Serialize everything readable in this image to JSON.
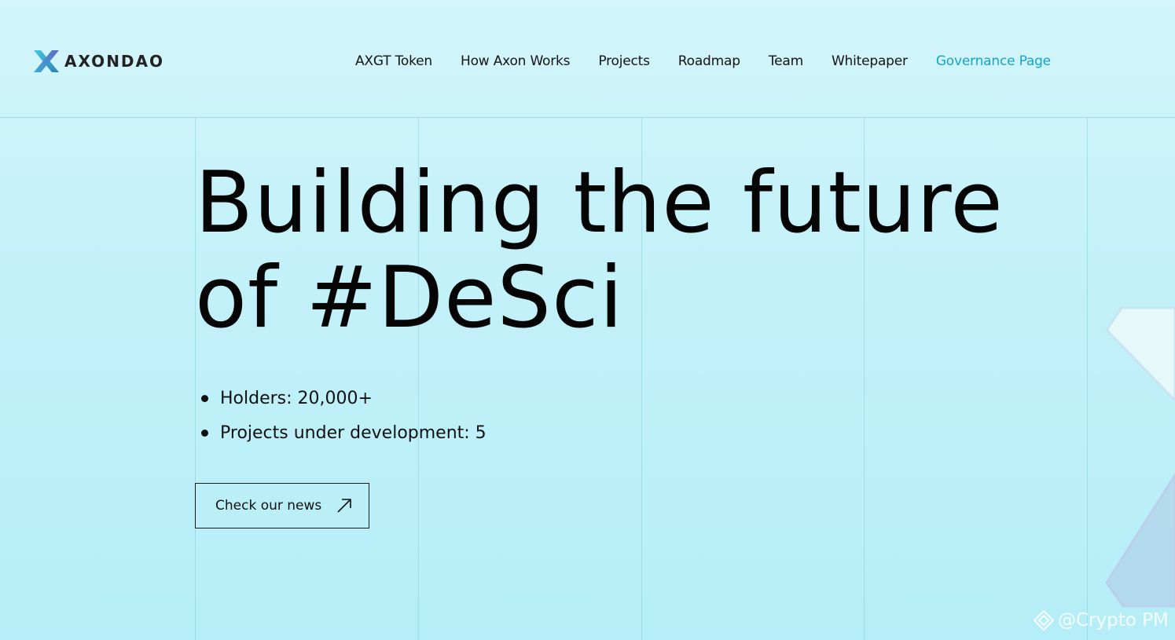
{
  "brand": {
    "name": "AXONDAO",
    "logo_icon": "axon-x-logo-icon"
  },
  "nav": {
    "items": [
      {
        "label": "AXGT Token"
      },
      {
        "label": "How Axon Works"
      },
      {
        "label": "Projects"
      },
      {
        "label": "Roadmap"
      },
      {
        "label": "Team"
      },
      {
        "label": "Whitepaper"
      },
      {
        "label": "Governance Page",
        "active": true
      }
    ]
  },
  "hero": {
    "title_line1": "Building the future",
    "title_line2": "of #DeSci",
    "stats": [
      "Holders: 20,000+",
      "Projects under development: 5"
    ],
    "cta_label": "Check our news",
    "cta_icon": "arrow-up-right-icon"
  },
  "watermark": {
    "text": "@Crypto PM",
    "icon": "binance-diamond-icon"
  },
  "colors": {
    "accent": "#14a3cc",
    "text": "#111111",
    "background_top": "#d3f5fb",
    "background_bottom": "#b5eef8"
  }
}
